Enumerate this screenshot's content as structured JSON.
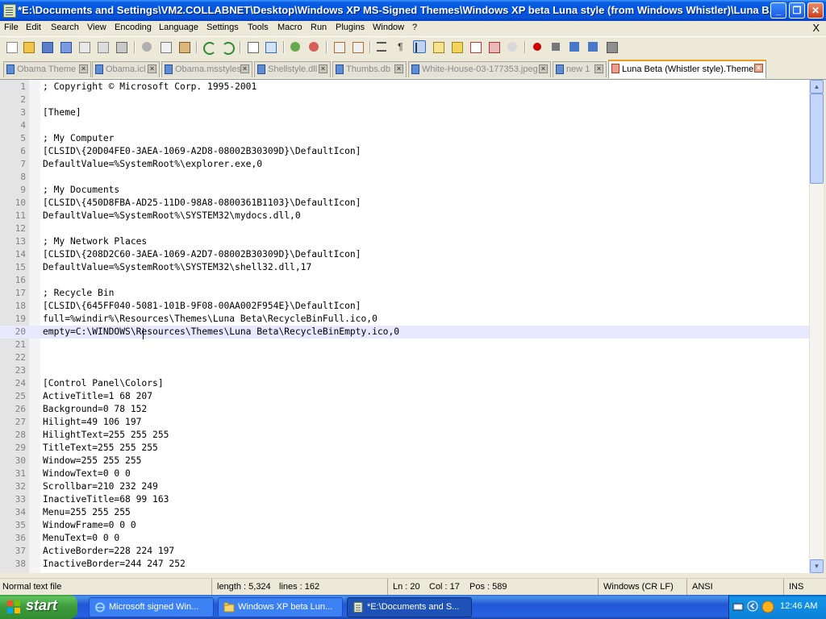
{
  "window": {
    "title": "*E:\\Documents and Settings\\VM2.COLLABNET\\Desktop\\Windows XP MS-Signed Themes\\Windows XP beta Luna style (from Windows Whistler)\\Luna B...",
    "min_glyph": "_",
    "max_glyph": "❐",
    "close_glyph": "✕"
  },
  "menu": {
    "items": [
      "File",
      "Edit",
      "Search",
      "View",
      "Encoding",
      "Language",
      "Settings",
      "Tools",
      "Macro",
      "Run",
      "Plugins",
      "Window",
      "?"
    ],
    "close_glyph": "X"
  },
  "tabs": [
    {
      "label": "Obama Theme",
      "active": false
    },
    {
      "label": "Obama.icl",
      "active": false
    },
    {
      "label": "Obama.msstyles",
      "active": false
    },
    {
      "label": "Shellstyle.dll",
      "active": false
    },
    {
      "label": "Thumbs.db",
      "active": false
    },
    {
      "label": "White-House-03-177353.jpeg",
      "active": false
    },
    {
      "label": "new 1",
      "active": false
    },
    {
      "label": "Luna Beta (Whistler style).Theme",
      "active": true
    }
  ],
  "editor": {
    "current_line": 20,
    "lines": [
      {
        "n": "1",
        "text": "; Copyright © Microsoft Corp. 1995-2001"
      },
      {
        "n": "2",
        "text": ""
      },
      {
        "n": "3",
        "text": "[Theme]"
      },
      {
        "n": "4",
        "text": ""
      },
      {
        "n": "5",
        "text": "; My Computer"
      },
      {
        "n": "6",
        "text": "[CLSID\\{20D04FE0-3AEA-1069-A2D8-08002B30309D}\\DefaultIcon]"
      },
      {
        "n": "7",
        "text": "DefaultValue=%SystemRoot%\\explorer.exe,0"
      },
      {
        "n": "8",
        "text": ""
      },
      {
        "n": "9",
        "text": "; My Documents"
      },
      {
        "n": "10",
        "text": "[CLSID\\{450D8FBA-AD25-11D0-98A8-0800361B1103}\\DefaultIcon]"
      },
      {
        "n": "11",
        "text": "DefaultValue=%SystemRoot%\\SYSTEM32\\mydocs.dll,0"
      },
      {
        "n": "12",
        "text": ""
      },
      {
        "n": "13",
        "text": "; My Network Places"
      },
      {
        "n": "14",
        "text": "[CLSID\\{208D2C60-3AEA-1069-A2D7-08002B30309D}\\DefaultIcon]"
      },
      {
        "n": "15",
        "text": "DefaultValue=%SystemRoot%\\SYSTEM32\\shell32.dll,17"
      },
      {
        "n": "16",
        "text": ""
      },
      {
        "n": "17",
        "text": "; Recycle Bin"
      },
      {
        "n": "18",
        "text": "[CLSID\\{645FF040-5081-101B-9F08-00AA002F954E}\\DefaultIcon]"
      },
      {
        "n": "19",
        "text": "full=%windir%\\Resources\\Themes\\Luna Beta\\RecycleBinFull.ico,0"
      },
      {
        "n": "20",
        "text": "empty=C:\\WINDOWS\\Resources\\Themes\\Luna Beta\\RecycleBinEmpty.ico,0"
      },
      {
        "n": "21",
        "text": ""
      },
      {
        "n": "22",
        "text": ""
      },
      {
        "n": "23",
        "text": ""
      },
      {
        "n": "24",
        "text": "[Control Panel\\Colors]"
      },
      {
        "n": "25",
        "text": "ActiveTitle=1 68 207"
      },
      {
        "n": "26",
        "text": "Background=0 78 152"
      },
      {
        "n": "27",
        "text": "Hilight=49 106 197"
      },
      {
        "n": "28",
        "text": "HilightText=255 255 255"
      },
      {
        "n": "29",
        "text": "TitleText=255 255 255"
      },
      {
        "n": "30",
        "text": "Window=255 255 255"
      },
      {
        "n": "31",
        "text": "WindowText=0 0 0"
      },
      {
        "n": "32",
        "text": "Scrollbar=210 232 249"
      },
      {
        "n": "33",
        "text": "InactiveTitle=68 99 163"
      },
      {
        "n": "34",
        "text": "Menu=255 255 255"
      },
      {
        "n": "35",
        "text": "WindowFrame=0 0 0"
      },
      {
        "n": "36",
        "text": "MenuText=0 0 0"
      },
      {
        "n": "37",
        "text": "ActiveBorder=228 224 197"
      },
      {
        "n": "38",
        "text": "InactiveBorder=244 247 252"
      }
    ]
  },
  "status": {
    "file_type": "Normal text file",
    "length": "length : 5,324",
    "lines": "lines : 162",
    "ln": "Ln : 20",
    "col": "Col : 17",
    "pos": "Pos : 589",
    "eol": "Windows (CR LF)",
    "encoding": "ANSI",
    "mode": "INS"
  },
  "taskbar": {
    "start_label": "start",
    "tasks": [
      {
        "label": "Microsoft signed Win...",
        "icon": "ie-icon",
        "active": false
      },
      {
        "label": "Windows XP beta Lun...",
        "icon": "folder-icon",
        "active": false
      },
      {
        "label": "*E:\\Documents and S...",
        "icon": "notepad-icon",
        "active": true
      }
    ],
    "clock": "12:46 AM"
  },
  "colors": {
    "titlebar": "#0054e3",
    "current_line": "#e8e8ff",
    "active_tab_accent": "#f09a20"
  }
}
